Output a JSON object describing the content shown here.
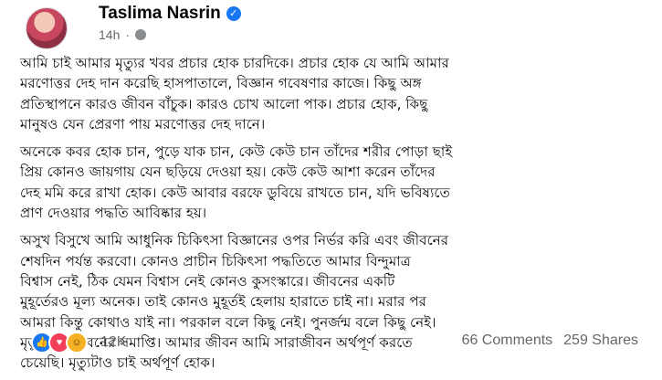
{
  "post": {
    "author": "Taslima Nasrin",
    "time": "14h",
    "paragraphs": [
      [
        "আমি চাই আমার মৃত্যুর খবর প্রচার হোক চারদিকে। প্রচার হোক যে আমি আমার",
        "মরণোত্তর দেহ দান করেছি হাসপাতালে, বিজ্ঞান গবেষণার কাজে। কিছু অঙ্গ",
        "প্রতিস্থাপনে কারও জীবন বাঁচুক। কারও চোখ আলো পাক। প্রচার হোক, কিছু",
        "মানুষও যেন প্রেরণা পায় মরণোত্তর দেহ দানে।"
      ],
      [
        "অনেকে কবর হোক চান, পুড়ে যাক চান, কেউ কেউ চান তাঁদের শরীর পোড়া ছাই",
        "প্রিয় কোনও জায়গায় যেন ছড়িয়ে দেওয়া হয়। কেউ কেউ আশা করেন তাঁদের",
        "দেহ মমি করে রাখা হোক। কেউ আবার বরফে ডুবিয়ে রাখতে চান, যদি ভবিষ্যতে",
        "প্রাণ দেওয়ার পদ্ধতি আবিষ্কার হয়।"
      ],
      [
        "অসুখ বিসুখে আমি আধুনিক চিকিৎসা বিজ্ঞানের ওপর নির্ভর করি এবং জীবনের",
        "শেষদিন পর্যন্ত করবো। কোনও প্রাচীন চিকিৎসা পদ্ধতিতে আমার বিন্দুমাত্র",
        "বিশ্বাস নেই, ঠিক যেমন বিশ্বাস নেই কোনও কুসংস্কারে। জীবনের একটি",
        "মুহূর্তেরও মূল্য অনেক। তাই কোনও মুহূর্তই হেলায় হারাতে চাই না। মরার পর",
        "আমরা কিন্তু কোথাও যাই না। পরকাল বলে কিছু নেই। পুনর্জন্ম বলে কিছু নেই।",
        "মৃত্যুতেই জীবনের সমাপ্তি। আমার জীবন আমি সারাজীবন অর্থপূর্ণ করতে",
        "চেয়েছি। মৃত্যুটাও চাই অর্থপূর্ণ হোক।"
      ]
    ]
  },
  "footer": {
    "reaction_count": "12K",
    "comments": "66 Comments",
    "shares": "259 Shares"
  }
}
